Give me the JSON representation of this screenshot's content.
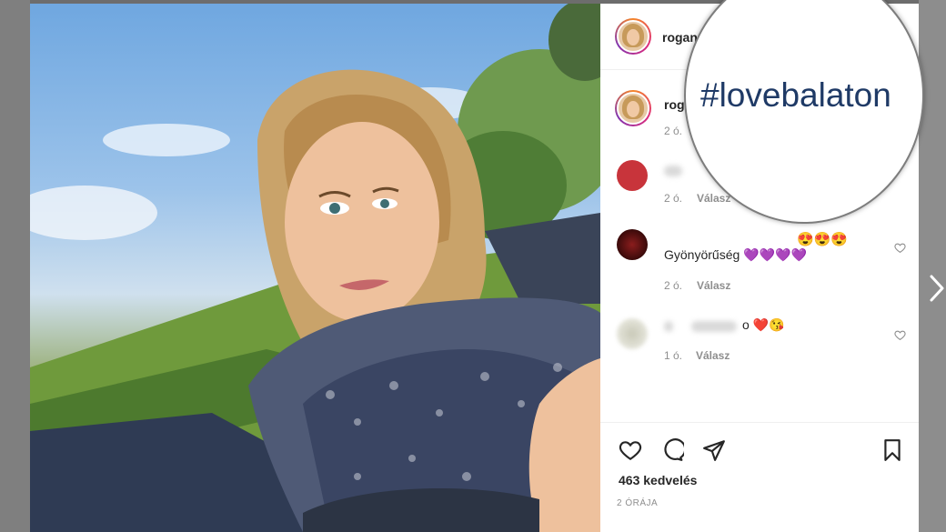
{
  "post": {
    "author": "rogance",
    "hashtag": "#lovebalaton",
    "likes": "463 kedvelés",
    "posted": "2 ÓRÁJA"
  },
  "comments": [
    {
      "time": "2 ó.",
      "text": "",
      "reply": ""
    },
    {
      "time": "2 ó.",
      "text": "",
      "reply": "Válasz"
    },
    {
      "time": "2 ó.",
      "text": "Gyönyörűség 💜💜💜💜",
      "emoji_top": "😍😍😍",
      "reply": "Válasz"
    },
    {
      "time": "1 ó.",
      "text": "o ❤️😘",
      "reply": "Válasz"
    }
  ],
  "caption_author": "roga",
  "icons": [
    "more-icon",
    "heart-icon",
    "comment-icon",
    "share-icon",
    "bookmark-icon",
    "chevron-right-icon"
  ],
  "colors": {
    "text": "#262626",
    "muted": "#8e8e8e",
    "hashtag": "#1f3a66"
  }
}
